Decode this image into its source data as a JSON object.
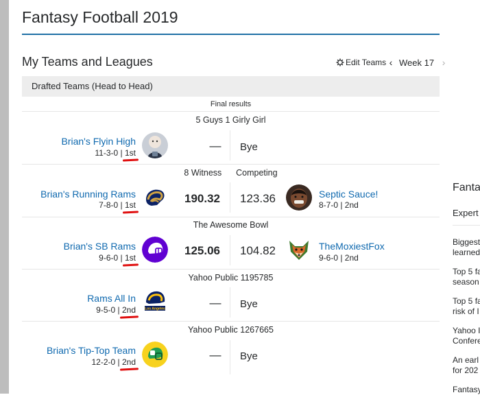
{
  "page": {
    "title": "Fantasy Football 2019"
  },
  "section": {
    "title": "My Teams and Leagues",
    "edit_teams": "Edit Teams",
    "week": "Week 17"
  },
  "drafted": {
    "header": "Drafted Teams (Head to Head)",
    "final_results": "Final results"
  },
  "leagues": [
    {
      "name": "5 Guys 1 Girly Girl",
      "team": {
        "name": "Brian's Flyin High",
        "record": "11-3-0 | ",
        "rank": "1st",
        "avatar_icon": "baby-photo-icon"
      },
      "score": "—",
      "opponent_score": "Bye"
    },
    {
      "name": "8 Witness      Competing",
      "team": {
        "name": "Brian's Running Rams",
        "record": "7-8-0 | ",
        "rank": "1st",
        "avatar_icon": "rams-horn-logo-icon"
      },
      "score": "190.32",
      "opponent_score": "123.36",
      "opponent": {
        "name": "Septic Sauce!",
        "record": "8-7-0 | 2nd",
        "avatar_icon": "player-photo-icon"
      }
    },
    {
      "name": "The Awesome Bowl",
      "team": {
        "name": "Brian's SB Rams",
        "record": "9-6-0 | ",
        "rank": "1st",
        "avatar_icon": "purple-helmet-icon"
      },
      "score": "125.06",
      "opponent_score": "104.82",
      "opponent": {
        "name": "TheMoxiestFox",
        "record": "9-6-0 | 2nd",
        "avatar_icon": "fox-logo-icon"
      }
    },
    {
      "name": "Yahoo Public 1195785",
      "team": {
        "name": "Rams All In",
        "record": "9-5-0 | ",
        "rank": "2nd",
        "avatar_icon": "los-angeles-rams-helmet-icon"
      },
      "score": "—",
      "opponent_score": "Bye"
    },
    {
      "name": "Yahoo Public 1267665",
      "team": {
        "name": "Brian's Tip-Top Team",
        "record": "12-2-0 | ",
        "rank": "2nd",
        "avatar_icon": "green-helmet-icon"
      },
      "score": "—",
      "opponent_score": "Bye"
    }
  ],
  "helmet_logo_text": "Los Angeles",
  "sidebar": {
    "title": "Fanta",
    "tab": "Expert",
    "items": [
      {
        "line1": "Biggest",
        "line2": "learned"
      },
      {
        "line1": "Top 5 fa",
        "line2": "season"
      },
      {
        "line1": "Top 5 fa",
        "line2": "risk of I"
      },
      {
        "line1": "Yahoo I",
        "line2": "Confere"
      },
      {
        "line1": "An earl",
        "line2": "for 202"
      },
      {
        "line1": "Fantasy",
        "line2": ""
      }
    ]
  },
  "colors": {
    "accent": "#1d6fa5",
    "link": "#0f69af",
    "underline": "#e01010",
    "header_bg": "#ededed"
  }
}
